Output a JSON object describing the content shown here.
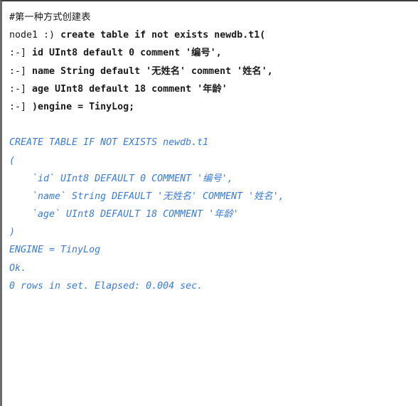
{
  "block": {
    "accent_border_color": "#6b6b6b",
    "top_border_color": "#3c3c3c",
    "background_color": "#ffffff",
    "input_color": "#191919",
    "output_color": "#3a7bd5"
  },
  "terminal": {
    "comment": "#第一种方式创建表",
    "input_lines": [
      {
        "prompt": "node1 :) ",
        "sql": "create table if not exists newdb.t1("
      },
      {
        "prompt": ":-] ",
        "sql": "id UInt8 default 0 comment '编号',"
      },
      {
        "prompt": ":-] ",
        "sql": "name String default '无姓名' comment '姓名',"
      },
      {
        "prompt": ":-] ",
        "sql": "age UInt8 default 18 comment '年龄'"
      },
      {
        "prompt": ":-] ",
        "sql": ")engine = TinyLog;"
      }
    ],
    "output_lines": [
      "CREATE TABLE IF NOT EXISTS newdb.t1",
      "(",
      "    `id` UInt8 DEFAULT 0 COMMENT '编号',",
      "    `name` String DEFAULT '无姓名' COMMENT '姓名',",
      "    `age` UInt8 DEFAULT 18 COMMENT '年龄'",
      ")",
      "ENGINE = TinyLog",
      "Ok.",
      "0 rows in set. Elapsed: 0.004 sec."
    ]
  }
}
